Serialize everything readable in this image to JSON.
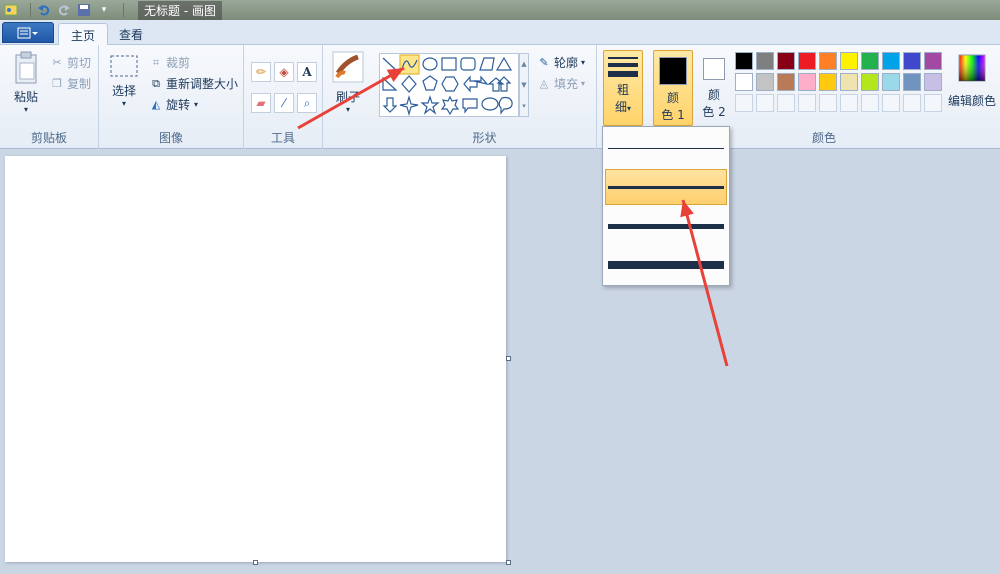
{
  "window": {
    "title": "无标题 - 画图"
  },
  "tabs": [
    {
      "label": "主页",
      "active": true
    },
    {
      "label": "查看",
      "active": false
    }
  ],
  "clipboard": {
    "paste": "粘贴",
    "cut": "剪切",
    "copy": "复制",
    "group": "剪贴板"
  },
  "image": {
    "select": "选择",
    "crop": "裁剪",
    "resize": "重新调整大小",
    "rotate": "旋转",
    "group": "图像"
  },
  "tools": {
    "group": "工具",
    "brushes": "刷子"
  },
  "shapes": {
    "outline": "轮廓",
    "fill": "填充",
    "group": "形状"
  },
  "size": {
    "label_line1": "粗",
    "label_line2": "细"
  },
  "colors": {
    "color1_line1": "颜",
    "color1_line2": "色 1",
    "color2_line1": "颜",
    "color2_line2": "色 2",
    "edit": "编辑颜色",
    "group": "颜色",
    "color1": "#000000",
    "color2": "#ffffff",
    "palette_row1": [
      "#000000",
      "#7f7f7f",
      "#880015",
      "#ed1c24",
      "#ff7f27",
      "#fff200",
      "#22b14c",
      "#00a2e8",
      "#3f48cc",
      "#a349a4"
    ],
    "palette_row2": [
      "#ffffff",
      "#c3c3c3",
      "#b97a57",
      "#ffaec9",
      "#ffc90e",
      "#efe4b0",
      "#b5e61d",
      "#99d9ea",
      "#7092be",
      "#c8bfe7"
    ]
  },
  "size_dropdown": {
    "options": [
      1,
      3,
      5,
      8
    ],
    "selected_index": 1
  },
  "annotations": {
    "arrow_color": "#e8413a"
  }
}
